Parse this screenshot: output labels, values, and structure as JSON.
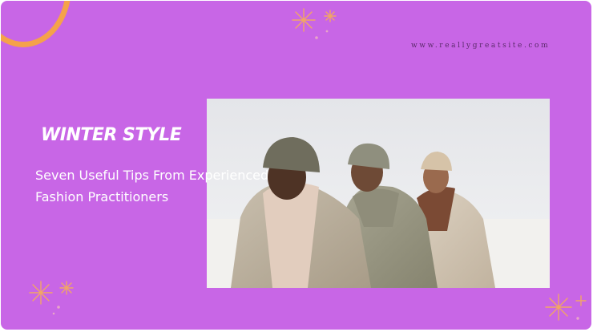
{
  "site": {
    "url": "www.reallygreatsite.com"
  },
  "heading": {
    "title": "WINTER STYLE"
  },
  "subheading": {
    "line1": "Seven Useful Tips From Experienced",
    "line2": "Fashion Practitioners"
  },
  "photo": {
    "subject": "three men in beanies and puffer jackets on a snowy landscape"
  },
  "colors": {
    "background": "#c866e6",
    "accent_orange": "#f5a24a",
    "text": "#ffffff"
  },
  "decorations": [
    "sparkle-icon",
    "sparkle-icon",
    "sparkle-icon",
    "arc-shape"
  ]
}
